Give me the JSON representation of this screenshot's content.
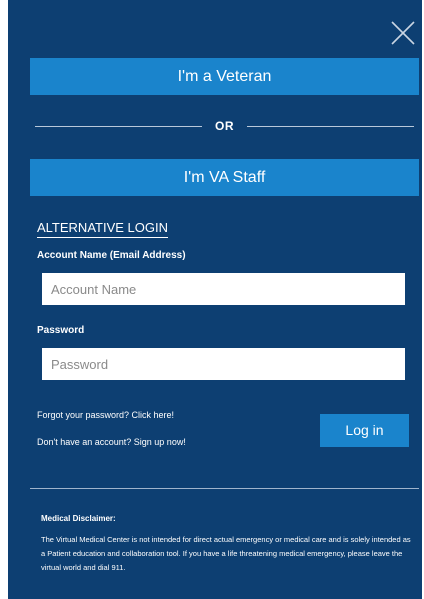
{
  "login": {
    "veteran_label": "I'm a Veteran",
    "or_label": "OR",
    "staff_label": "I'm VA Staff",
    "alternative_heading": "ALTERNATIVE LOGIN",
    "account_label": "Account Name (Email Address)",
    "account_placeholder": "Account Name",
    "password_label": "Password",
    "password_placeholder": "Password",
    "forgot_link": "Forgot your password? Click here!",
    "signup_link": "Don't have an account? Sign up now!",
    "login_button": "Log in"
  },
  "disclaimer": {
    "title": "Medical Disclaimer:",
    "body": "The Virtual Medical Center is not intended for direct actual emergency or medical care and is solely intended as a Patient education and collaboration tool. If you have a life threatening medical emergency, please leave the virtual world and dial 911."
  },
  "icons": {
    "close": "close-icon"
  },
  "colors": {
    "panel_background": "#0d3f72",
    "button_blue": "#1a84cc",
    "text": "#ffffff"
  }
}
